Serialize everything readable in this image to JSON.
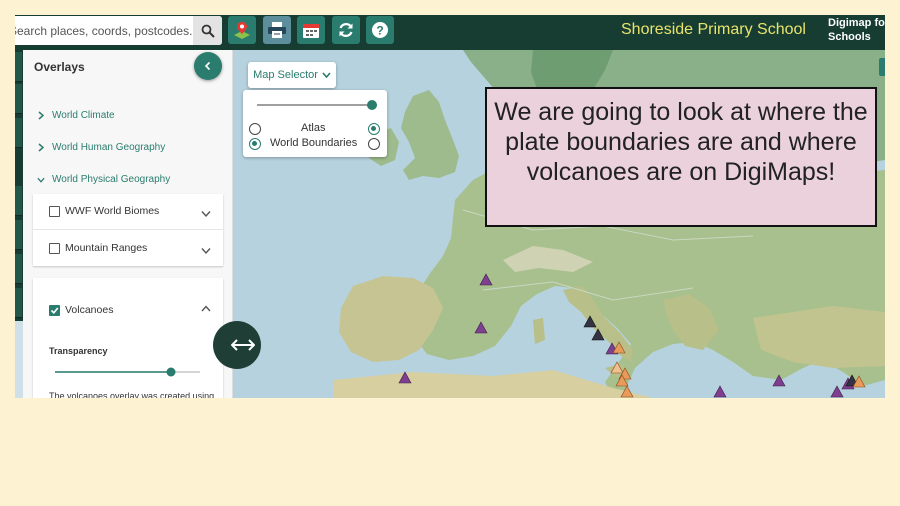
{
  "search": {
    "placeholder": "Search places, coords, postcodes..."
  },
  "header": {
    "school_name": "Shoreside Primary School",
    "brand_line1": "Digimap for",
    "brand_line2": "Schools",
    "tool_icons": [
      "layers-marker-icon",
      "print-icon",
      "calendar-icon",
      "refresh-icon",
      "help-icon"
    ]
  },
  "overlays": {
    "title": "Overlays",
    "categories": [
      {
        "label": "World Climate",
        "expanded": false
      },
      {
        "label": "World Human Geography",
        "expanded": false
      },
      {
        "label": "World Physical Geography",
        "expanded": true
      }
    ],
    "layers": [
      {
        "label": "WWF World Biomes",
        "checked": false
      },
      {
        "label": "Mountain Ranges",
        "checked": false
      },
      {
        "label": "Volcanoes",
        "checked": true
      }
    ],
    "volcanoes": {
      "transparency_label": "Transparency",
      "transparency_value": 0.8,
      "description": "The volcanoes overlay was created using data downloaded from the"
    }
  },
  "map_selector": {
    "button_label": "Map Selector",
    "slider_value": 1.0,
    "options": [
      {
        "label": "Atlas",
        "left_selected": false,
        "right_selected": true
      },
      {
        "label": "World Boundaries",
        "left_selected": true,
        "right_selected": false
      }
    ]
  },
  "callout": {
    "text": "We are going to look at where the plate boundaries are and where volcanoes are on DigiMaps!"
  },
  "colors": {
    "topbar": "#173d33",
    "accent": "#2a7d6e",
    "school_name": "#e8e36a",
    "callout_bg": "#ead1dc",
    "slide_bg": "#fdf3d2",
    "volcano_purple": "#7e3f8f",
    "volcano_dark": "#333344",
    "volcano_orange": "#e89a5a"
  }
}
